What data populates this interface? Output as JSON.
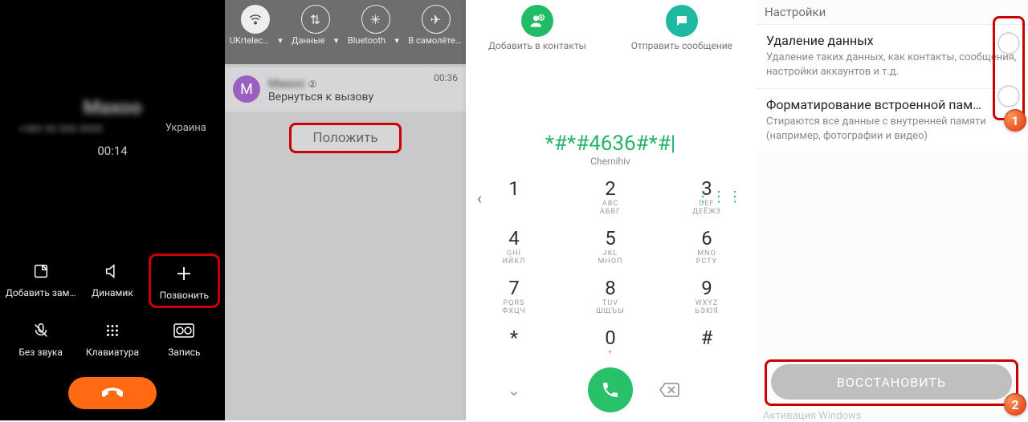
{
  "panel1": {
    "contact_name": "Maxoo",
    "contact_sub": "+380 00 000 0000",
    "country": "Украина",
    "elapsed": "00:14",
    "buttons": {
      "note": "Добавить зам…",
      "speaker": "Динамик",
      "call": "Позвонить",
      "mute": "Без звука",
      "keypad": "Клавиатура",
      "record": "Запись"
    }
  },
  "panel2": {
    "qs": {
      "wifi": "UKrtelec…",
      "data": "Данные",
      "bt": "Bluetooth",
      "plane": "В самолёте…"
    },
    "avatar_letter": "М",
    "notif_name": "Maxoo",
    "notif_sup": "②",
    "notif_time": "00:36",
    "return_line": "Вернуться к вызову",
    "hang_up": "Положить"
  },
  "panel3": {
    "add_contact": "Добавить в контакты",
    "send_msg": "Отправить сообщение",
    "dialed": "*#*#4636#*#|",
    "under": "Chernihiv",
    "keys": [
      {
        "n": "1",
        "l": ""
      },
      {
        "n": "2",
        "l": "ABC\nАБВГ"
      },
      {
        "n": "3",
        "l": "DEF\nДЕЁЖЗ"
      },
      {
        "n": "4",
        "l": "GHI\nИЙКЛ"
      },
      {
        "n": "5",
        "l": "JKL\nМНОП"
      },
      {
        "n": "6",
        "l": "MNO\nРСТУ"
      },
      {
        "n": "7",
        "l": "PQRS\nФХЦЧ"
      },
      {
        "n": "8",
        "l": "TUV\nШЩЪЫ"
      },
      {
        "n": "9",
        "l": "WXYZ\nЬЭЮЯ"
      },
      {
        "n": "*",
        "l": ""
      },
      {
        "n": "0",
        "l": "+"
      },
      {
        "n": "#",
        "l": ""
      }
    ]
  },
  "panel4": {
    "header": "Настройки",
    "item1_title": "Удаление данных",
    "item1_desc": "Удаление таких данных, как контакты, сообщения, настройки аккаунтов и т.д.",
    "item2_title": "Форматирование встроенной пам…",
    "item2_desc": "Стираются все данные с внутренней памяти (например, фотографии и видео)",
    "restore": "ВОССТАНОВИТЬ",
    "watermark": "Активация Windows",
    "badge1": "1",
    "badge2": "2"
  }
}
